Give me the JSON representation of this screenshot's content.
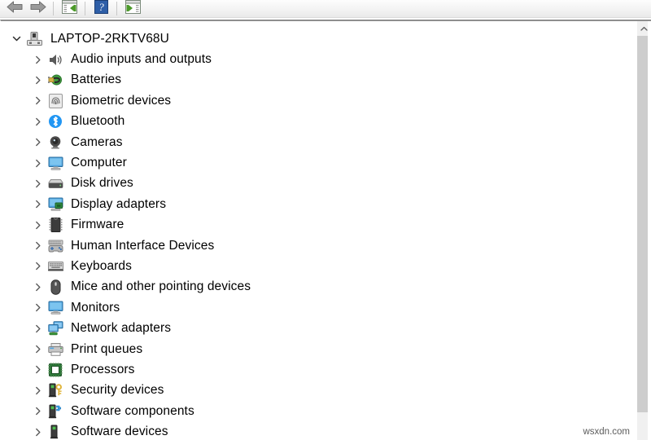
{
  "toolbar": {
    "buttons": [
      {
        "name": "back-button",
        "icon": "back-arrow-icon",
        "label": "Back"
      },
      {
        "name": "forward-button",
        "icon": "forward-arrow-icon",
        "label": "Forward"
      },
      {
        "name": "show-hide-console-tree",
        "icon": "console-tree-icon",
        "label": "Show/Hide Console Tree"
      },
      {
        "name": "help-button",
        "icon": "help-question-icon",
        "label": "Help"
      },
      {
        "name": "show-hide-action-pane",
        "icon": "action-pane-icon",
        "label": "Show/Hide Action Pane"
      }
    ]
  },
  "tree": {
    "root": {
      "label": "LAPTOP-2RKTV68U",
      "icon": "computer-tower-icon",
      "expanded": true
    },
    "items": [
      {
        "label": "Audio inputs and outputs",
        "icon": "speaker-icon",
        "expanded": false
      },
      {
        "label": "Batteries",
        "icon": "battery-plug-icon",
        "expanded": false
      },
      {
        "label": "Biometric devices",
        "icon": "fingerprint-icon",
        "expanded": false
      },
      {
        "label": "Bluetooth",
        "icon": "bluetooth-icon",
        "expanded": false
      },
      {
        "label": "Cameras",
        "icon": "camera-icon",
        "expanded": false
      },
      {
        "label": "Computer",
        "icon": "monitor-icon",
        "expanded": false
      },
      {
        "label": "Disk drives",
        "icon": "disk-drive-icon",
        "expanded": false
      },
      {
        "label": "Display adapters",
        "icon": "display-adapter-icon",
        "expanded": false
      },
      {
        "label": "Firmware",
        "icon": "firmware-chip-icon",
        "expanded": false
      },
      {
        "label": "Human Interface Devices",
        "icon": "gamepad-icon",
        "expanded": false
      },
      {
        "label": "Keyboards",
        "icon": "keyboard-icon",
        "expanded": false
      },
      {
        "label": "Mice and other pointing devices",
        "icon": "mouse-icon",
        "expanded": false
      },
      {
        "label": "Monitors",
        "icon": "monitor-icon",
        "expanded": false
      },
      {
        "label": "Network adapters",
        "icon": "network-adapter-icon",
        "expanded": false
      },
      {
        "label": "Print queues",
        "icon": "printer-icon",
        "expanded": false
      },
      {
        "label": "Processors",
        "icon": "processor-chip-icon",
        "expanded": false
      },
      {
        "label": "Security devices",
        "icon": "security-key-icon",
        "expanded": false
      },
      {
        "label": "Software components",
        "icon": "software-puzzle-icon",
        "expanded": false
      },
      {
        "label": "Software devices",
        "icon": "software-device-icon",
        "expanded": false
      }
    ]
  },
  "scrollbar": {
    "up_arrow_icon": "chevron-up-icon",
    "position": "top"
  },
  "watermark": {
    "text": "wsxdn.com"
  },
  "colors": {
    "accent_blue": "#2196f3",
    "green": "#4caf50",
    "toolbar_bg": "#f0f0f0",
    "scrollbar_thumb": "#cdcdcd",
    "text": "#000000"
  }
}
